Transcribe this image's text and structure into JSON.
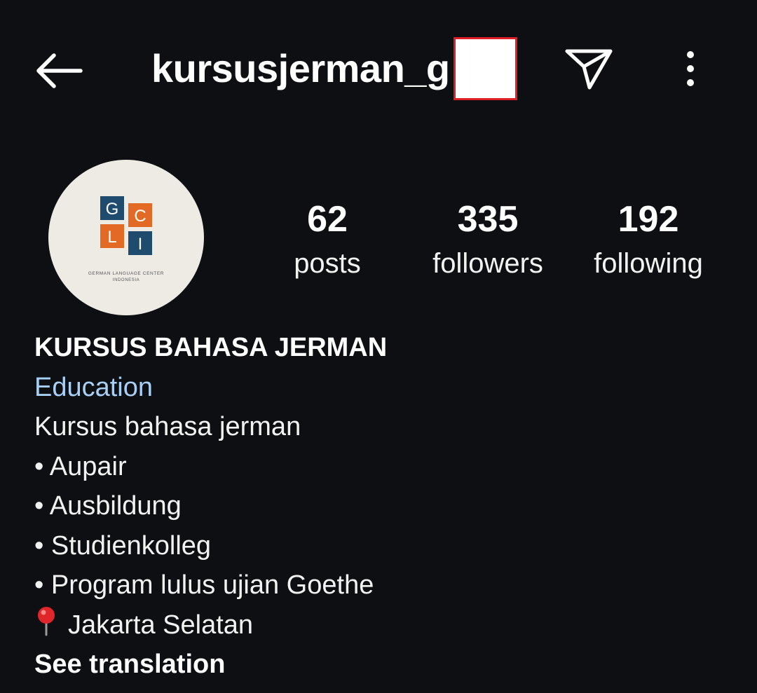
{
  "header": {
    "username": "kursusjerman_g",
    "back_icon": "arrow-left-icon",
    "send_icon": "paper-plane-icon",
    "more_icon": "more-vertical-icon"
  },
  "avatar": {
    "logo_letters": [
      "G",
      "C",
      "L",
      "I"
    ],
    "logo_caption_line1": "GERMAN LANGUAGE CENTER",
    "logo_caption_line2": "INDONESIA",
    "colors": {
      "blue": "#1f4b6e",
      "orange": "#e26a24"
    }
  },
  "stats": {
    "posts": {
      "value": "62",
      "label": "posts"
    },
    "followers": {
      "value": "335",
      "label": "followers"
    },
    "following": {
      "value": "192",
      "label": "following"
    }
  },
  "bio": {
    "name": "KURSUS BAHASA JERMAN",
    "category": "Education",
    "description": "Kursus bahasa jerman",
    "bullets": [
      "• Aupair",
      "• Ausbildung",
      "• Studienkolleg",
      "• Program lulus ujian Goethe"
    ],
    "location_icon": "map-pin-icon",
    "location": "Jakarta Selatan",
    "see_translation": "See translation"
  },
  "colors": {
    "background": "#0d0f13",
    "category_link": "#a8d0f5",
    "redaction_border": "#e01e26"
  }
}
